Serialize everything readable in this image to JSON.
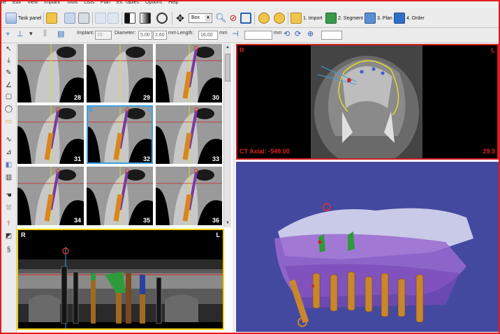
{
  "menu": [
    "ile",
    "Edit",
    "View",
    "Implant",
    "Tools",
    "Lists",
    "Plan",
    "Ex. Tables",
    "Options",
    "Help"
  ],
  "toolbar": {
    "task_panel_label": "Task panel",
    "view_mode": "Box",
    "steps": [
      {
        "label": "1. Import",
        "icon": "import-folder-icon"
      },
      {
        "label": "2. Segment",
        "icon": "segment-icon"
      },
      {
        "label": "3. Plan",
        "icon": "plan-icon"
      },
      {
        "label": "4. Order",
        "icon": "order-cart-icon"
      }
    ]
  },
  "implant_bar": {
    "implant_label": "Implant:",
    "implant_value": "15",
    "diameter_label": "Diameter:",
    "diameter_value": "5,00",
    "diameter_value2": "2,60",
    "diameter_unit": "mm",
    "length_label": "Length:",
    "length_value": "16,00",
    "length_unit": "mm",
    "offset_unit": "mm"
  },
  "slices": {
    "numbers": [
      "28",
      "29",
      "30",
      "31",
      "32",
      "33",
      "34",
      "35",
      "36"
    ],
    "selected_index": 4,
    "selected_tag_left": "B",
    "selected_tag_right": "L"
  },
  "panoramic": {
    "left_label": "R",
    "right_label": "L"
  },
  "axial": {
    "left_label": "R",
    "right_label": "L",
    "readout": "CT Axial: -549.00",
    "readout_right": "29.5"
  },
  "colors": {
    "frame": "#e31b1b",
    "axial_border": "#d21e1e",
    "pano_border": "#f0d000",
    "selected_cell": "#3aa0e0",
    "view3d_bg": "#4449a0",
    "implant": "#c8862e",
    "tissue": "#9a6ad0"
  }
}
